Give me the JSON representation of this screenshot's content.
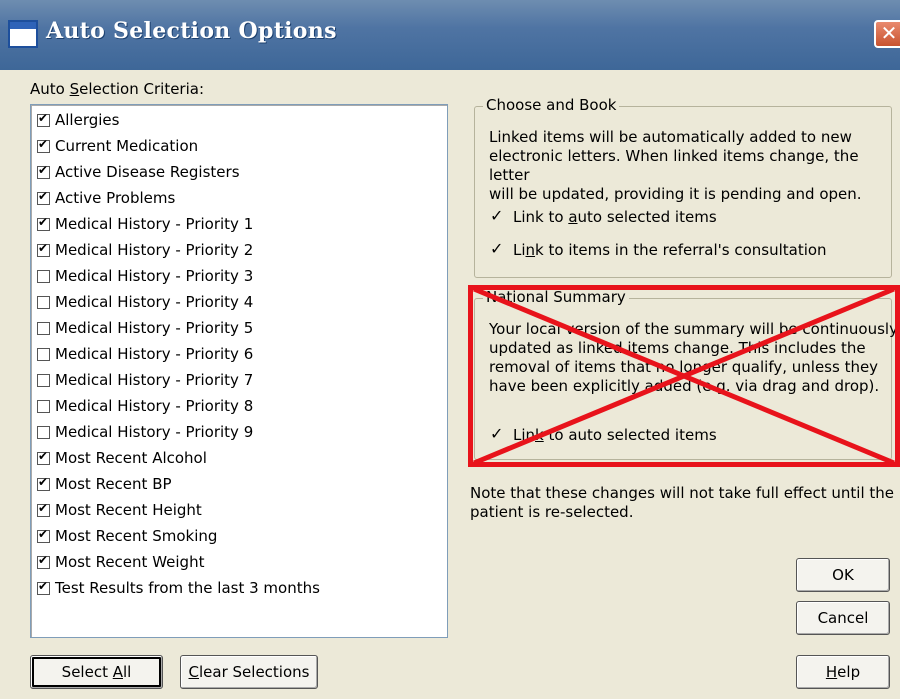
{
  "window": {
    "title": "Auto Selection Options",
    "close_glyph": "✕"
  },
  "criteria": {
    "label_pre": "Auto ",
    "label_key": "S",
    "label_post": "election Criteria:",
    "items": [
      {
        "label": "Allergies",
        "checked": true
      },
      {
        "label": "Current Medication",
        "checked": true
      },
      {
        "label": "Active Disease Registers",
        "checked": true
      },
      {
        "label": "Active Problems",
        "checked": true
      },
      {
        "label": "Medical History - Priority 1",
        "checked": true
      },
      {
        "label": "Medical History - Priority 2",
        "checked": true
      },
      {
        "label": "Medical History - Priority 3",
        "checked": false
      },
      {
        "label": "Medical History - Priority 4",
        "checked": false
      },
      {
        "label": "Medical History - Priority 5",
        "checked": false
      },
      {
        "label": "Medical History - Priority 6",
        "checked": false
      },
      {
        "label": "Medical History - Priority 7",
        "checked": false
      },
      {
        "label": "Medical History - Priority 8",
        "checked": false
      },
      {
        "label": "Medical History - Priority 9",
        "checked": false
      },
      {
        "label": "Most Recent Alcohol",
        "checked": true
      },
      {
        "label": "Most Recent BP",
        "checked": true
      },
      {
        "label": "Most Recent Height",
        "checked": true
      },
      {
        "label": "Most Recent Smoking",
        "checked": true
      },
      {
        "label": "Most Recent Weight",
        "checked": true
      },
      {
        "label": "Test Results from the last 3 months",
        "checked": true
      }
    ]
  },
  "buttons": {
    "select_all_pre": "Select ",
    "select_all_key": "A",
    "select_all_post": "ll",
    "clear_key": "C",
    "clear_post": "lear Selections",
    "ok": "OK",
    "cancel": "Cancel",
    "help_key": "H",
    "help_post": "elp"
  },
  "choose_and_book": {
    "title": "Choose and Book",
    "desc_lines": [
      "Linked items will be automatically added to new",
      "electronic letters. When linked items change, the letter",
      "will be updated, providing it is pending and open."
    ],
    "opt1_pre": "Link to ",
    "opt1_key": "a",
    "opt1_post": "uto selected items",
    "opt1_checked": true,
    "opt2_pre": "Li",
    "opt2_key": "n",
    "opt2_post": "k to items in the referral's consultation",
    "opt2_checked": true
  },
  "national_summary": {
    "title": "National Summary",
    "desc_lines": [
      "Your local version of the summary will be continuously",
      "updated as linked items change. This includes the",
      "removal of items that no longer qualify, unless they",
      "have been explicitly added (e.g. via drag and drop)."
    ],
    "opt_pre": "Lin",
    "opt_key": "k",
    "opt_post": " to auto selected items",
    "opt_checked": true,
    "annotation_color": "#e8131b"
  },
  "note_lines": [
    "Note that these changes will not take full effect until the",
    "patient is re-selected."
  ]
}
